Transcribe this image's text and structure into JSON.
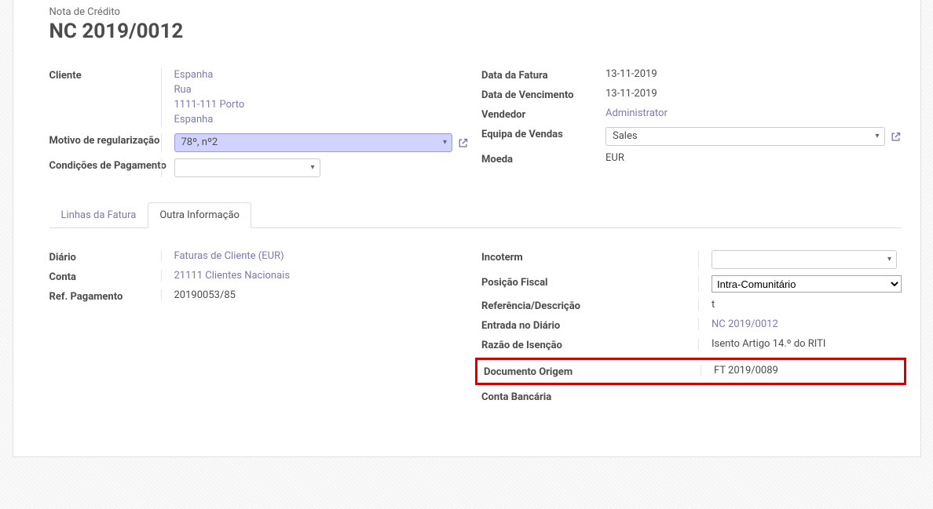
{
  "header": {
    "doc_type": "Nota de Crédito",
    "doc_number": "NC 2019/0012"
  },
  "left_fields": {
    "cliente_label": "Cliente",
    "cliente": {
      "name": "Espanha",
      "line1": "Rua",
      "line2": "1111-111 Porto",
      "line3": "Espanha"
    },
    "motivo_label": "Motivo de regularização",
    "motivo_value": "78º, nº2",
    "condicoes_label": "Condições de Pagamento",
    "condicoes_value": ""
  },
  "right_fields": {
    "data_fatura_label": "Data da Fatura",
    "data_fatura_value": "13-11-2019",
    "data_venc_label": "Data de Vencimento",
    "data_venc_value": "13-11-2019",
    "vendedor_label": "Vendedor",
    "vendedor_value": "Administrator",
    "equipa_label": "Equipa de Vendas",
    "equipa_value": "Sales",
    "moeda_label": "Moeda",
    "moeda_value": "EUR"
  },
  "tabs": {
    "linhas": "Linhas da Fatura",
    "outra": "Outra Informação"
  },
  "outra_left": {
    "diario_label": "Diário",
    "diario_value": "Faturas de Cliente (EUR)",
    "conta_label": "Conta",
    "conta_value": "21111 Clientes Nacionais",
    "ref_label": "Ref. Pagamento",
    "ref_value": "20190053/85"
  },
  "outra_right": {
    "incoterm_label": "Incoterm",
    "incoterm_value": "",
    "posicao_label": "Posição Fiscal",
    "posicao_value": "Intra-Comunitário",
    "referencia_label": "Referência/Descrição",
    "referencia_value": "t",
    "entrada_label": "Entrada no Diário",
    "entrada_value": "NC 2019/0012",
    "razao_label": "Razão de Isenção",
    "razao_value": "Isento Artigo 14.º do RITI",
    "doc_origem_label": "Documento Origem",
    "doc_origem_value": "FT 2019/0089",
    "conta_bancaria_label": "Conta Bancária",
    "conta_bancaria_value": ""
  }
}
